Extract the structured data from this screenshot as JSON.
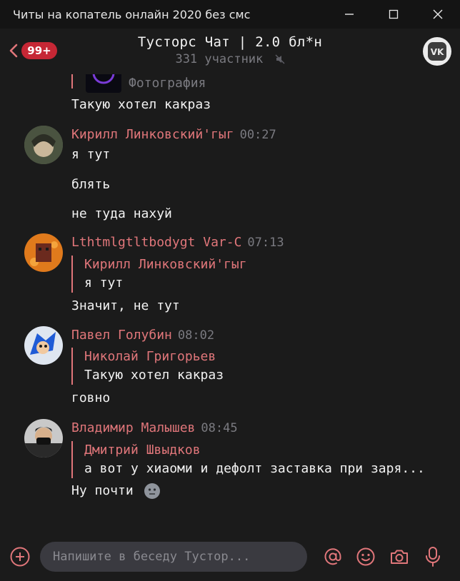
{
  "window": {
    "title": "Читы на копатель онлайн 2020 без смс"
  },
  "header": {
    "badge": "99+",
    "title": "Тусторс Чат | 2.0 бл*н",
    "subtitle": "331 участник"
  },
  "messages": {
    "m0": {
      "quote_label": "Фотография",
      "text": "Такую хотел какраз"
    },
    "m1": {
      "author": "Кирилл Линковский'гыг",
      "time": "00:27",
      "lines": [
        "я тут",
        "блять",
        "не туда нахуй"
      ]
    },
    "m2": {
      "author": "Lthtmlgtltbodygt Var-C",
      "time": "07:13",
      "quote_author": "Кирилл Линковский'гыг",
      "quote_text": "я тут",
      "text": "Значит, не тут"
    },
    "m3": {
      "author": "Павел Голубин",
      "time": "08:02",
      "quote_author": "Николай Григорьев",
      "quote_text": "Такую хотел какраз",
      "text": "говно"
    },
    "m4": {
      "author": "Владимир Малышев",
      "time": "08:45",
      "quote_author": "Дмитрий Швыдков",
      "quote_text": "а вот у хиаоми и дефолт заставка при заря...",
      "text": "Ну почти"
    }
  },
  "composer": {
    "placeholder": "Напишите в беседу Тустор..."
  },
  "colors": {
    "accent": "#e0767a",
    "badge": "#c62735",
    "background": "#1b1b1b",
    "muted_text": "#7a7a80"
  },
  "icons": [
    "minimize-icon",
    "maximize-icon",
    "close-icon",
    "back-chevron-icon",
    "mute-icon",
    "vk-logo-icon",
    "add-icon",
    "mention-icon",
    "emoji-icon",
    "camera-icon",
    "microphone-icon"
  ]
}
